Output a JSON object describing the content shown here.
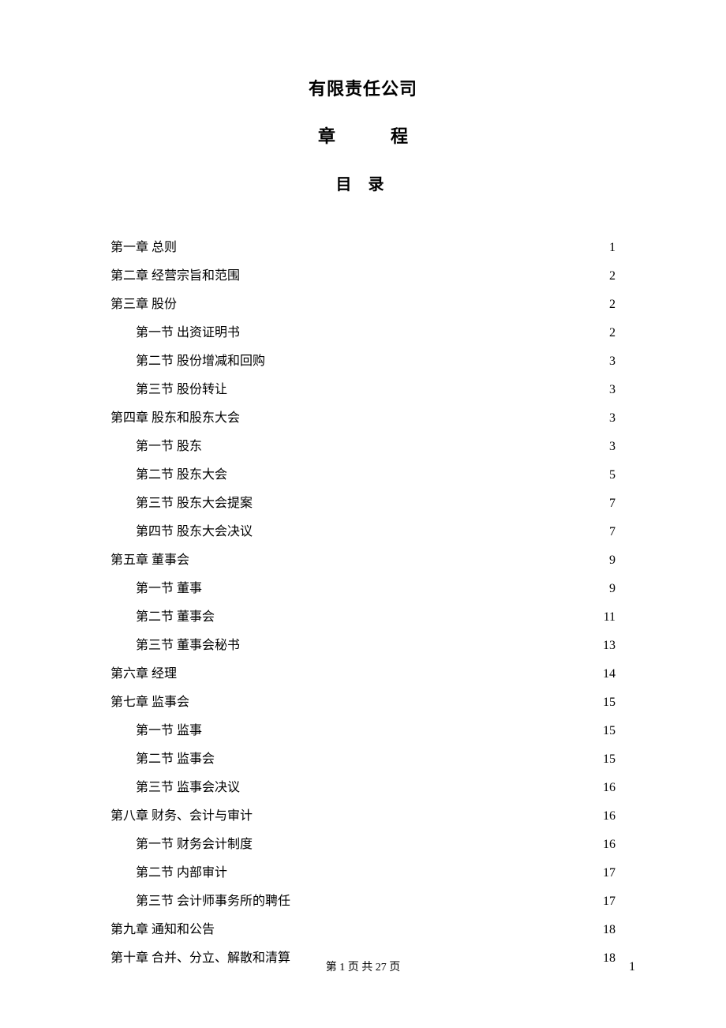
{
  "title": {
    "line1": "有限责任公司",
    "line2a": "章",
    "line2b": "程",
    "toc": "目 录"
  },
  "toc": [
    {
      "level": "chapter",
      "label": "第一章 总则",
      "page": "1"
    },
    {
      "level": "chapter",
      "label": "第二章 经营宗旨和范围",
      "page": "2"
    },
    {
      "level": "chapter",
      "label": "第三章 股份",
      "page": "2"
    },
    {
      "level": "section",
      "label": "第一节 出资证明书",
      "page": "2"
    },
    {
      "level": "section",
      "label": "第二节 股份增减和回购",
      "page": "3"
    },
    {
      "level": "section",
      "label": "第三节 股份转让",
      "page": "3"
    },
    {
      "level": "chapter",
      "label": "第四章 股东和股东大会",
      "page": "3"
    },
    {
      "level": "section",
      "label": "第一节 股东",
      "page": "3"
    },
    {
      "level": "section",
      "label": "第二节 股东大会",
      "page": "5"
    },
    {
      "level": "section",
      "label": "第三节 股东大会提案",
      "page": "7"
    },
    {
      "level": "section",
      "label": "第四节 股东大会决议",
      "page": "7"
    },
    {
      "level": "chapter",
      "label": "第五章 董事会",
      "page": "9"
    },
    {
      "level": "section",
      "label": "第一节 董事",
      "page": "9"
    },
    {
      "level": "section",
      "label": "第二节 董事会",
      "page": "11"
    },
    {
      "level": "section",
      "label": "第三节 董事会秘书",
      "page": "13"
    },
    {
      "level": "chapter",
      "label": "第六章 经理",
      "page": "14"
    },
    {
      "level": "chapter",
      "label": "第七章 监事会",
      "page": "15"
    },
    {
      "level": "section",
      "label": "第一节 监事",
      "page": "15"
    },
    {
      "level": "section",
      "label": "第二节 监事会",
      "page": "15"
    },
    {
      "level": "section",
      "label": "第三节 监事会决议",
      "page": "16"
    },
    {
      "level": "chapter",
      "label": "第八章  财务、会计与审计",
      "page": "16"
    },
    {
      "level": "section",
      "label": "第一节 财务会计制度",
      "page": "16"
    },
    {
      "level": "section",
      "label": "第二节 内部审计",
      "page": "17"
    },
    {
      "level": "section",
      "label": "第三节 会计师事务所的聘任",
      "page": "17"
    },
    {
      "level": "chapter",
      "label": "第九章 通知和公告",
      "page": "18"
    },
    {
      "level": "chapter",
      "label": "第十章 合并、分立、解散和清算",
      "page": "18"
    }
  ],
  "footer": {
    "center": "第 1 页 共 27 页",
    "right": "1"
  }
}
